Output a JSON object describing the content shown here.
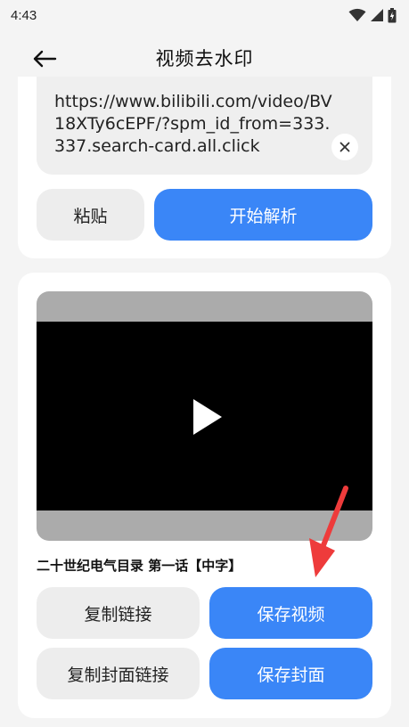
{
  "status_bar": {
    "time": "4:43"
  },
  "app_bar": {
    "title": "视频去水印"
  },
  "input_card": {
    "url_value": "https://www.bilibili.com/video/BV18XTy6cEPF/?spm_id_from=333.337.search-card.all.click",
    "paste_label": "粘贴",
    "parse_label": "开始解析"
  },
  "result_card": {
    "video_title": "二十世纪电气目录 第一话【中字】",
    "copy_link_label": "复制链接",
    "save_video_label": "保存视频",
    "copy_cover_link_label": "复制封面链接",
    "save_cover_label": "保存封面"
  },
  "colors": {
    "accent": "#3a86f7",
    "annotation_arrow": "#ee3b3b",
    "secondary_button": "#ededed"
  },
  "icons": [
    "wifi-icon",
    "signal-icon",
    "battery-icon",
    "back-arrow-icon",
    "clear-icon",
    "play-icon",
    "annotation-arrow-icon"
  ]
}
